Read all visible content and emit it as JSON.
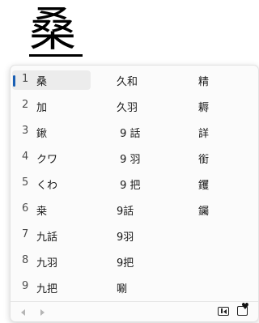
{
  "composition": {
    "text": "桑"
  },
  "candidates": [
    {
      "num": "1",
      "col1": "桑",
      "col2": "久和",
      "col3": "精",
      "selected": true
    },
    {
      "num": "2",
      "col1": "加",
      "col2": "久羽",
      "col3": "耨"
    },
    {
      "num": "3",
      "col1": "鍬",
      "col2": " 9 話",
      "col3": "詳"
    },
    {
      "num": "4",
      "col1": "クワ",
      "col2": " 9 羽",
      "col3": "銜"
    },
    {
      "num": "5",
      "col1": "くわ",
      "col2": " 9 把",
      "col3": "钁"
    },
    {
      "num": "6",
      "col1": "桒",
      "col2": "9話",
      "col3": "钃"
    },
    {
      "num": "7",
      "col1": "九話",
      "col2": "9羽",
      "col3": ""
    },
    {
      "num": "8",
      "col1": "九羽",
      "col2": "9把",
      "col3": ""
    },
    {
      "num": "9",
      "col1": "九把",
      "col2": "唰",
      "col3": ""
    }
  ],
  "footer": {
    "prev_icon": "chevron-left-icon",
    "next_icon": "chevron-right-icon",
    "expand_icon": "expand-panel-icon",
    "favorite_icon": "favorite-icon",
    "accent": "#1a5fb4"
  }
}
